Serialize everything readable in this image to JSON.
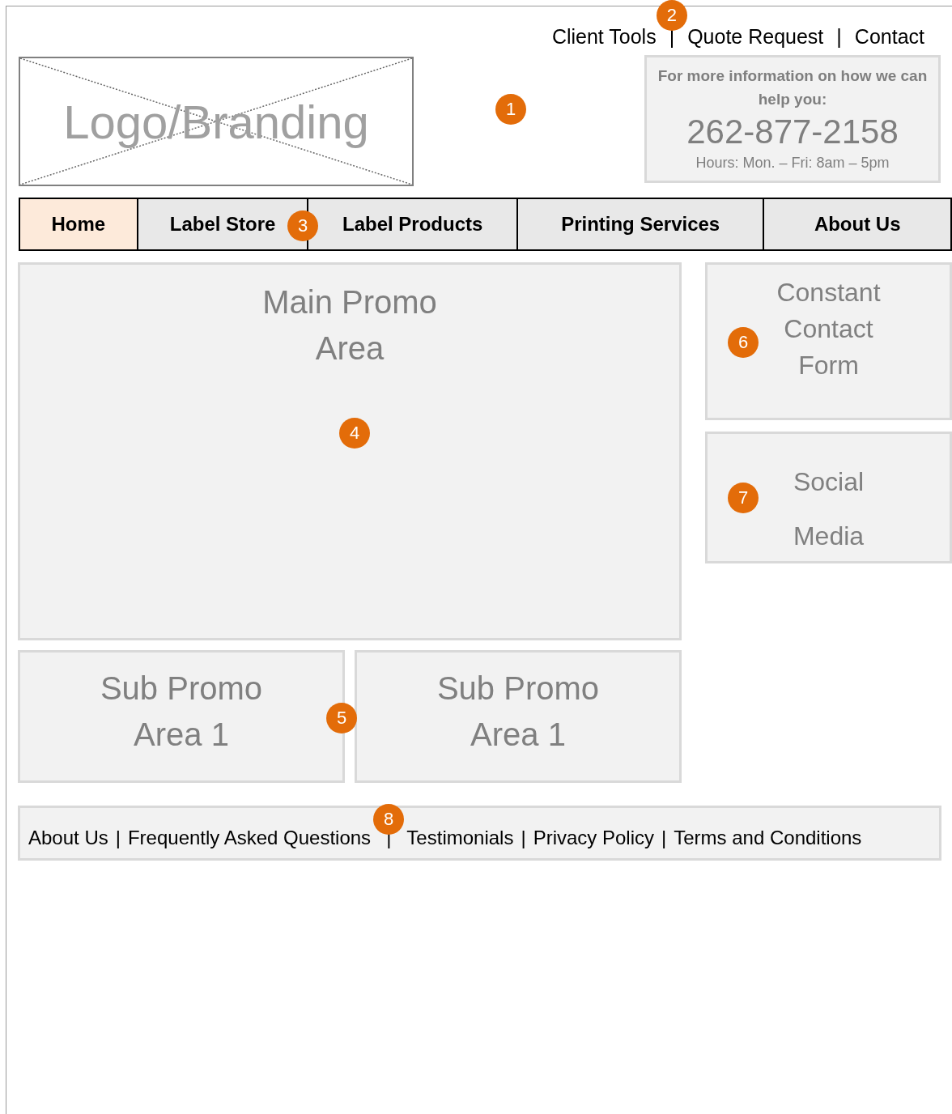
{
  "top_links": [
    {
      "label": "Client Tools"
    },
    {
      "label": "|"
    },
    {
      "label": "Quote Request"
    },
    {
      "label": "|"
    },
    {
      "label": "Contact"
    }
  ],
  "logo": {
    "text": "Logo/Branding"
  },
  "contact_box": {
    "intro": "For more information on how we can help you:",
    "phone": "262-877-2158",
    "hours": "Hours: Mon. – Fri: 8am – 5pm"
  },
  "nav": [
    {
      "label": "Home",
      "selected": true
    },
    {
      "label": "Label Store",
      "selected": false
    },
    {
      "label": "Label Products",
      "selected": false
    },
    {
      "label": "Printing Services",
      "selected": false
    },
    {
      "label": "About Us",
      "selected": false
    }
  ],
  "main_promo": {
    "lines": [
      "Main Promo",
      "Area"
    ]
  },
  "sub_promos": [
    {
      "lines": [
        "Sub Promo",
        "Area 1"
      ]
    },
    {
      "lines": [
        "Sub Promo",
        "Area 1"
      ]
    }
  ],
  "sidebar": [
    {
      "lines": [
        "Constant",
        "Contact",
        "Form"
      ]
    },
    {
      "lines": [
        "Social",
        "Media"
      ]
    }
  ],
  "footer": {
    "separator": "|",
    "links": [
      "About Us",
      "Frequently Asked Questions",
      "Testimonials",
      "Privacy Policy",
      "Terms and Conditions"
    ]
  },
  "annotations": [
    "1",
    "2",
    "3",
    "4",
    "5",
    "6",
    "7",
    "8"
  ]
}
